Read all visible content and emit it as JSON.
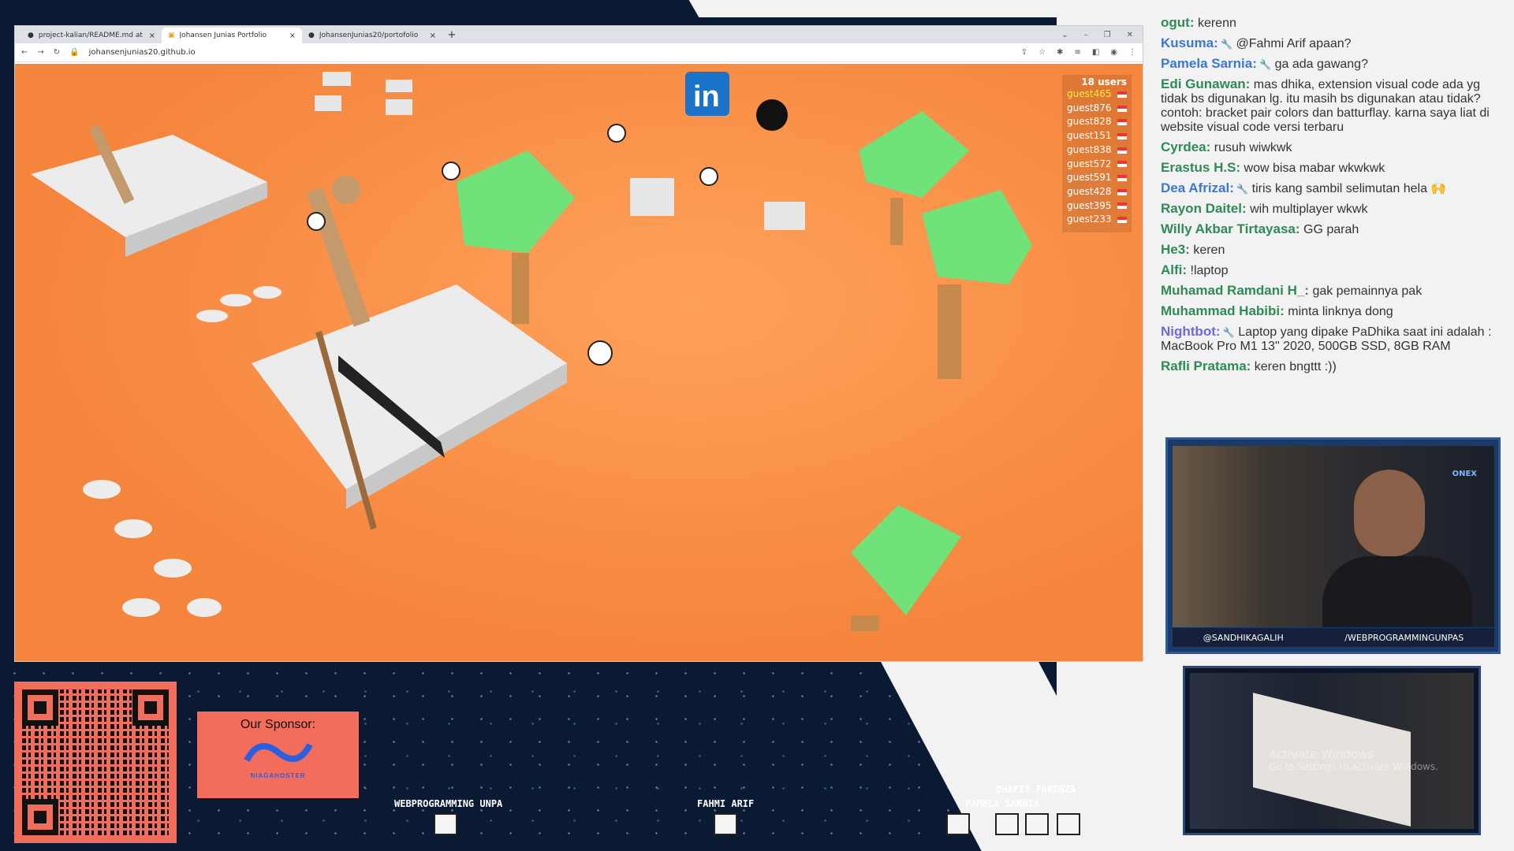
{
  "browser": {
    "tabs": [
      {
        "title": "project-kalian/README.md at",
        "active": false
      },
      {
        "title": "Johansen Junias Portfolio",
        "active": true
      },
      {
        "title": "JohansenJunias20/portofolio",
        "active": false
      }
    ],
    "url": "johansenjunias20.github.io"
  },
  "scene": {
    "users_count": "18 users",
    "users": [
      "guest465",
      "guest876",
      "guest828",
      "guest151",
      "guest838",
      "guest572",
      "guest591",
      "guest428",
      "guest395",
      "guest233"
    ]
  },
  "chat": [
    {
      "name": "ogut:",
      "text": "kerenn",
      "color": "#2e8b57"
    },
    {
      "name": "Kusuma:",
      "text": "@Fahmi Arif apaan?",
      "color": "#3a78d8",
      "badge": true
    },
    {
      "name": "Pamela Sarnia:",
      "text": "ga ada gawang?",
      "color": "#3a78d8",
      "badge": true
    },
    {
      "name": "Edi Gunawan:",
      "text": "mas dhika, extension visual code ada yg tidak bs digunakan lg. itu masih bs digunakan atau tidak? contoh: bracket pair colors dan batturflay. karna saya liat di website visual code versi terbaru",
      "color": "#2e8b57"
    },
    {
      "name": "Cyrdea:",
      "text": "rusuh wiwkwk",
      "color": "#2e8b57"
    },
    {
      "name": "Erastus H.S:",
      "text": "wow bisa mabar wkwkwk",
      "color": "#2e8b57"
    },
    {
      "name": "Dea Afrizal:",
      "text": "tiris kang sambil selimutan hela 🙌",
      "color": "#3a78d8",
      "badge": true
    },
    {
      "name": "Rayon Daitel:",
      "text": "wih multiplayer wkwk",
      "color": "#2e8b57"
    },
    {
      "name": "Willy Akbar Tirtayasa:",
      "text": "GG parah",
      "color": "#2e8b57"
    },
    {
      "name": "He3:",
      "text": "keren",
      "color": "#2e8b57"
    },
    {
      "name": "Alfi:",
      "text": "!laptop",
      "color": "#2e8b57"
    },
    {
      "name": "Muhamad Ramdani H_:",
      "text": "gak pemainnya pak",
      "color": "#2e8b57"
    },
    {
      "name": "Muhammad Habibi:",
      "text": "minta linknya dong",
      "color": "#2e8b57"
    },
    {
      "name": "Nightbot:",
      "text": "Laptop yang dipake PaDhika saat ini adalah : MacBook Pro M1 13\" 2020, 500GB SSD, 8GB RAM",
      "color": "#6a6ae0",
      "badge": true
    },
    {
      "name": "Rafli Pratama:",
      "text": "keren bngttt :))",
      "color": "#2e8b57"
    }
  ],
  "webcam": {
    "handle": "@SANDHIKAGALIH",
    "channel": "/WEBPROGRAMMINGUNPAS",
    "brand": "ONEX"
  },
  "cam2": {
    "watermark1": "Activate Windows",
    "watermark2": "Go to Settings to activate Windows."
  },
  "sponsor": {
    "title": "Our Sponsor:",
    "name": "NIAGAHOSTER"
  },
  "viewers": [
    "WEBPROGRAMMING UNPA",
    "FAHMI ARIF",
    "DHAFIT FARENZA",
    "PAMELA SARNIA"
  ]
}
